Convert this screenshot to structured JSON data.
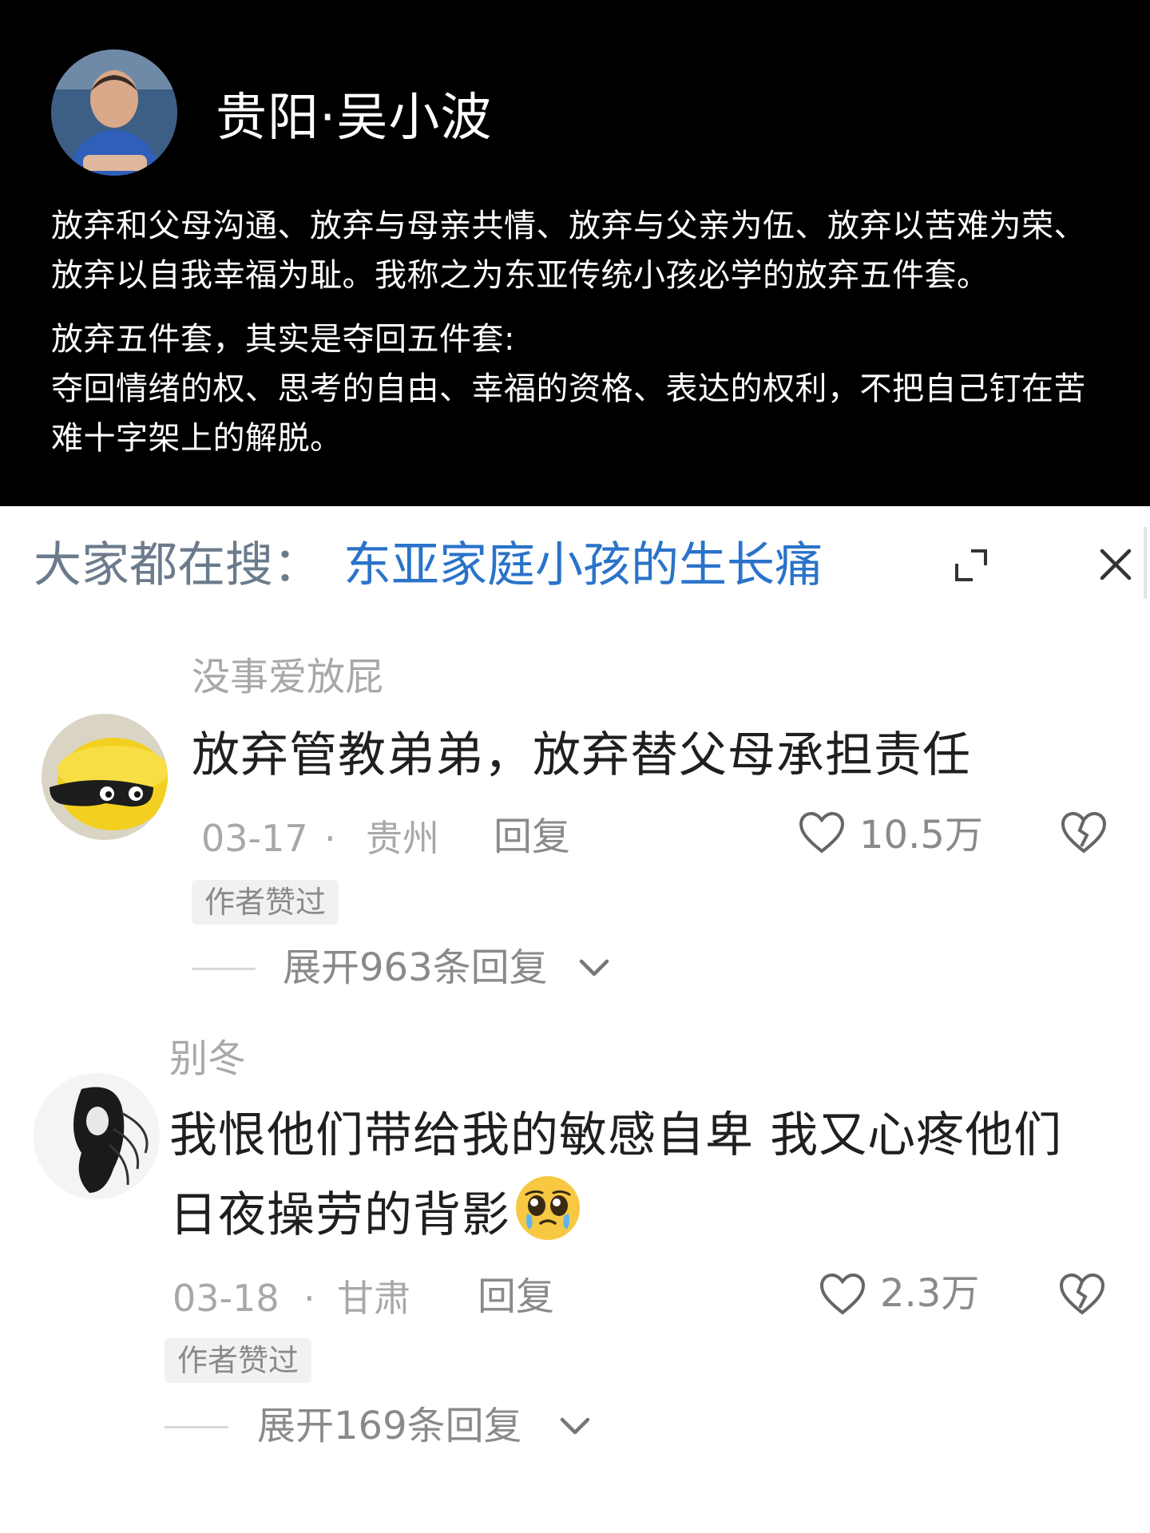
{
  "post": {
    "author": "贵阳·吴小波",
    "paragraph1": "放弃和父母沟通、放弃与母亲共情、放弃与父亲为伍、放弃以苦难为荣、放弃以自我幸福为耻。我称之为东亚传统小孩必学的放弃五件套。",
    "paragraph2_line1": "放弃五件套，其实是夺回五件套:",
    "paragraph2_line2": "夺回情绪的权、思考的自由、幸福的资格、表达的权利，不把自己钉在苦难十字架上的解脱。"
  },
  "search": {
    "prefix": "大家都在搜：",
    "term": "东亚家庭小孩的生长痛"
  },
  "comments": [
    {
      "username": "没事爱放屁",
      "text": "放弃管教弟弟，放弃替父母承担责任",
      "date": "03-17",
      "separator": "·",
      "location": "贵州",
      "reply_label": "回复",
      "likes": "10.5万",
      "badge": "作者赞过",
      "expand_label": "展开963条回复"
    },
    {
      "username": "别冬",
      "text_line1": "我恨他们带给我的敏感自卑 我又心疼他们",
      "text_line2": "日夜操劳的背影",
      "emoji": "pleading-face-emoji",
      "date": "03-18",
      "separator": "·",
      "location": "甘肃",
      "reply_label": "回复",
      "likes": "2.3万",
      "badge": "作者赞过",
      "expand_label": "展开169条回复"
    }
  ]
}
